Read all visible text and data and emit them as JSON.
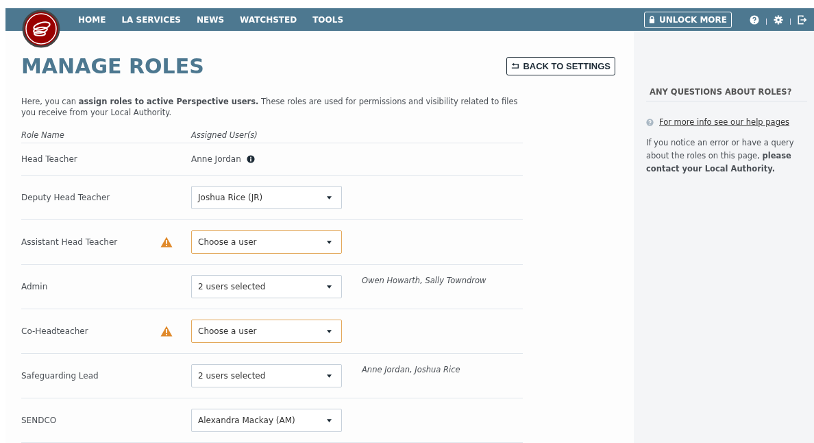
{
  "nav": {
    "items": [
      "HOME",
      "LA SERVICES",
      "NEWS",
      "WATCHSTED",
      "TOOLS"
    ],
    "unlock_button": "UNLOCK MORE"
  },
  "page": {
    "title": "MANAGE ROLES",
    "back_button": "BACK TO SETTINGS",
    "intro": "Here, you can **assign roles to active Perspective users.** These roles are used for permissions and visibility related to files you receive from your Local Authority."
  },
  "table": {
    "columns": [
      "Role Name",
      "Assigned User(s)"
    ],
    "rows": [
      {
        "role": "Head Teacher",
        "kind": "text",
        "warning": false,
        "value": "Anne Jordan"
      },
      {
        "role": "Deputy Head Teacher",
        "kind": "select",
        "warning": false,
        "value": "Joshua Rice (JR)"
      },
      {
        "role": "Assistant Head Teacher",
        "kind": "select",
        "warning": true,
        "placeholder": "Choose a user"
      },
      {
        "role": "Admin",
        "kind": "select",
        "warning": false,
        "value": "2 users selected",
        "note": "Owen Howarth, Sally Towndrow"
      },
      {
        "role": "Co-Headteacher",
        "kind": "select",
        "warning": true,
        "placeholder": "Choose a user"
      },
      {
        "role": "Safeguarding Lead",
        "kind": "select",
        "warning": false,
        "value": "2 users selected",
        "note": "Anne Jordan, Joshua Rice"
      },
      {
        "role": "SENDCO",
        "kind": "select",
        "warning": false,
        "value": "Alexandra Mackay (AM)"
      }
    ]
  },
  "sidebar": {
    "heading": "ANY QUESTIONS ABOUT ROLES?",
    "help_link": "For more info see our help pages",
    "text": "If you notice an error or have a query about the roles on this page, **please contact your Local Authority.**"
  }
}
